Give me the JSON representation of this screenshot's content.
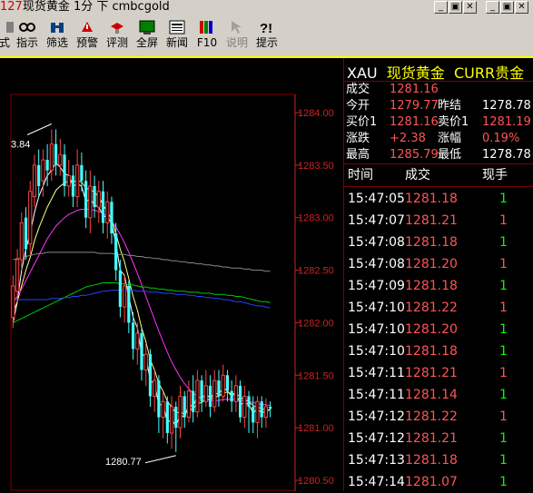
{
  "window": {
    "title_prefix": "127",
    "title_main": "现货黄金 1分 下 cmbcgold",
    "controls": [
      "_",
      "▣",
      "✕",
      "_",
      "▣",
      "✕"
    ]
  },
  "toolbar": {
    "items": [
      {
        "label": "式",
        "icon": "formula-icon"
      },
      {
        "label": "指示",
        "icon": "indicator-icon"
      },
      {
        "label": "筛选",
        "icon": "binoculars-icon"
      },
      {
        "label": "预警",
        "icon": "alert-icon"
      },
      {
        "label": "评测",
        "icon": "evaluate-icon"
      },
      {
        "label": "全屏",
        "icon": "fullscreen-icon"
      },
      {
        "label": "新闻",
        "icon": "news-icon"
      },
      {
        "label": "F10",
        "icon": "books-icon"
      },
      {
        "label": "说明",
        "icon": "help-arrow-icon",
        "disabled": true
      },
      {
        "label": "提示",
        "icon": "hint-icon"
      }
    ]
  },
  "chart": {
    "price_labels": [
      "1284.00",
      "1283.50",
      "1283.00",
      "1282.50",
      "1282.00",
      "1281.50",
      "1281.00",
      "1280.50"
    ],
    "high_annotation": "3.84",
    "low_annotation": "1280.77"
  },
  "chart_data": {
    "type": "candlestick",
    "ylim": [
      1280.5,
      1284.1
    ],
    "yticks": [
      1280.5,
      1281.0,
      1281.5,
      1282.0,
      1282.5,
      1283.0,
      1283.5,
      1284.0
    ],
    "candles": [
      {
        "o": 1282.05,
        "c": 1282.35,
        "h": 1282.45,
        "l": 1281.95,
        "up": true
      },
      {
        "o": 1282.3,
        "c": 1282.6,
        "h": 1282.7,
        "l": 1282.2,
        "up": true
      },
      {
        "o": 1282.6,
        "c": 1282.95,
        "h": 1283.05,
        "l": 1282.5,
        "up": true
      },
      {
        "o": 1283.0,
        "c": 1282.7,
        "h": 1283.1,
        "l": 1282.6,
        "up": false
      },
      {
        "o": 1282.75,
        "c": 1283.25,
        "h": 1283.35,
        "l": 1282.65,
        "up": true
      },
      {
        "o": 1283.2,
        "c": 1283.5,
        "h": 1283.6,
        "l": 1283.1,
        "up": true
      },
      {
        "o": 1283.5,
        "c": 1283.3,
        "h": 1283.65,
        "l": 1283.2,
        "up": false
      },
      {
        "o": 1283.35,
        "c": 1283.55,
        "h": 1283.65,
        "l": 1283.2,
        "up": true
      },
      {
        "o": 1283.55,
        "c": 1283.45,
        "h": 1283.7,
        "l": 1283.3,
        "up": false
      },
      {
        "o": 1283.45,
        "c": 1283.7,
        "h": 1283.84,
        "l": 1283.35,
        "up": true
      },
      {
        "o": 1283.7,
        "c": 1283.5,
        "h": 1283.84,
        "l": 1283.4,
        "up": false
      },
      {
        "o": 1283.5,
        "c": 1283.6,
        "h": 1283.75,
        "l": 1283.4,
        "up": true
      },
      {
        "o": 1283.6,
        "c": 1283.3,
        "h": 1283.7,
        "l": 1283.2,
        "up": false
      },
      {
        "o": 1283.3,
        "c": 1283.4,
        "h": 1283.55,
        "l": 1283.2,
        "up": true
      },
      {
        "o": 1283.4,
        "c": 1283.2,
        "h": 1283.5,
        "l": 1283.1,
        "up": false
      },
      {
        "o": 1283.2,
        "c": 1283.5,
        "h": 1283.65,
        "l": 1283.1,
        "up": true
      },
      {
        "o": 1283.5,
        "c": 1283.35,
        "h": 1283.62,
        "l": 1283.25,
        "up": false
      },
      {
        "o": 1283.35,
        "c": 1283.0,
        "h": 1283.45,
        "l": 1282.9,
        "up": false
      },
      {
        "o": 1283.0,
        "c": 1283.3,
        "h": 1283.45,
        "l": 1282.85,
        "up": true
      },
      {
        "o": 1283.3,
        "c": 1283.1,
        "h": 1283.4,
        "l": 1283.0,
        "up": false
      },
      {
        "o": 1283.1,
        "c": 1283.25,
        "h": 1283.35,
        "l": 1282.95,
        "up": true
      },
      {
        "o": 1283.25,
        "c": 1282.95,
        "h": 1283.35,
        "l": 1282.85,
        "up": false
      },
      {
        "o": 1282.95,
        "c": 1283.15,
        "h": 1283.25,
        "l": 1282.8,
        "up": true
      },
      {
        "o": 1283.15,
        "c": 1282.85,
        "h": 1283.2,
        "l": 1282.75,
        "up": false
      },
      {
        "o": 1282.85,
        "c": 1282.5,
        "h": 1282.95,
        "l": 1282.4,
        "up": false
      },
      {
        "o": 1282.5,
        "c": 1282.15,
        "h": 1282.6,
        "l": 1282.05,
        "up": false
      },
      {
        "o": 1282.15,
        "c": 1282.35,
        "h": 1282.45,
        "l": 1282.0,
        "up": true
      },
      {
        "o": 1282.35,
        "c": 1282.0,
        "h": 1282.4,
        "l": 1281.9,
        "up": false
      },
      {
        "o": 1282.0,
        "c": 1281.75,
        "h": 1282.1,
        "l": 1281.65,
        "up": false
      },
      {
        "o": 1281.75,
        "c": 1281.9,
        "h": 1282.0,
        "l": 1281.6,
        "up": true
      },
      {
        "o": 1281.9,
        "c": 1281.55,
        "h": 1281.95,
        "l": 1281.45,
        "up": false
      },
      {
        "o": 1281.55,
        "c": 1281.7,
        "h": 1281.8,
        "l": 1281.4,
        "up": true
      },
      {
        "o": 1281.7,
        "c": 1281.3,
        "h": 1281.75,
        "l": 1281.2,
        "up": false
      },
      {
        "o": 1281.3,
        "c": 1281.45,
        "h": 1281.55,
        "l": 1281.15,
        "up": true
      },
      {
        "o": 1281.45,
        "c": 1281.1,
        "h": 1281.5,
        "l": 1280.95,
        "up": false
      },
      {
        "o": 1281.1,
        "c": 1281.25,
        "h": 1281.35,
        "l": 1280.9,
        "up": true
      },
      {
        "o": 1281.25,
        "c": 1280.95,
        "h": 1281.3,
        "l": 1280.85,
        "up": false
      },
      {
        "o": 1280.95,
        "c": 1281.2,
        "h": 1281.3,
        "l": 1280.8,
        "up": true
      },
      {
        "o": 1281.2,
        "c": 1281.0,
        "h": 1281.25,
        "l": 1280.77,
        "up": false
      },
      {
        "o": 1281.0,
        "c": 1281.3,
        "h": 1281.4,
        "l": 1280.9,
        "up": true
      },
      {
        "o": 1281.3,
        "c": 1281.1,
        "h": 1281.35,
        "l": 1281.0,
        "up": false
      },
      {
        "o": 1281.1,
        "c": 1281.35,
        "h": 1281.45,
        "l": 1281.05,
        "up": true
      },
      {
        "o": 1281.35,
        "c": 1281.15,
        "h": 1281.5,
        "l": 1281.05,
        "up": false
      },
      {
        "o": 1281.15,
        "c": 1281.45,
        "h": 1281.55,
        "l": 1281.1,
        "up": true
      },
      {
        "o": 1281.45,
        "c": 1281.25,
        "h": 1281.5,
        "l": 1281.15,
        "up": false
      },
      {
        "o": 1281.25,
        "c": 1281.4,
        "h": 1281.55,
        "l": 1281.2,
        "up": true
      },
      {
        "o": 1281.4,
        "c": 1281.2,
        "h": 1281.5,
        "l": 1281.1,
        "up": false
      },
      {
        "o": 1281.2,
        "c": 1281.45,
        "h": 1281.55,
        "l": 1281.15,
        "up": true
      },
      {
        "o": 1281.45,
        "c": 1281.3,
        "h": 1281.55,
        "l": 1281.2,
        "up": false
      },
      {
        "o": 1281.3,
        "c": 1281.5,
        "h": 1281.6,
        "l": 1281.25,
        "up": true
      },
      {
        "o": 1281.5,
        "c": 1281.35,
        "h": 1281.55,
        "l": 1281.25,
        "up": false
      },
      {
        "o": 1281.35,
        "c": 1281.25,
        "h": 1281.45,
        "l": 1281.15,
        "up": false
      },
      {
        "o": 1281.25,
        "c": 1281.4,
        "h": 1281.5,
        "l": 1281.15,
        "up": true
      },
      {
        "o": 1281.4,
        "c": 1281.1,
        "h": 1281.45,
        "l": 1281.05,
        "up": false
      },
      {
        "o": 1281.1,
        "c": 1281.3,
        "h": 1281.4,
        "l": 1281.0,
        "up": true
      },
      {
        "o": 1281.3,
        "c": 1281.2,
        "h": 1281.35,
        "l": 1280.95,
        "up": false
      },
      {
        "o": 1281.2,
        "c": 1281.05,
        "h": 1281.3,
        "l": 1280.95,
        "up": false
      },
      {
        "o": 1281.05,
        "c": 1281.25,
        "h": 1281.3,
        "l": 1280.9,
        "up": true
      },
      {
        "o": 1281.25,
        "c": 1281.1,
        "h": 1281.3,
        "l": 1281.0,
        "up": false
      },
      {
        "o": 1281.1,
        "c": 1281.2,
        "h": 1281.28,
        "l": 1281.0,
        "up": true
      },
      {
        "o": 1281.2,
        "c": 1281.18,
        "h": 1281.25,
        "l": 1281.1,
        "up": false
      }
    ],
    "ma_series": [
      {
        "color": "#ffffff",
        "points": [
          1282.0,
          1282.2,
          1282.5,
          1282.7,
          1282.85,
          1283.05,
          1283.2,
          1283.3,
          1283.4,
          1283.45,
          1283.52,
          1283.48,
          1283.42,
          1283.4,
          1283.3,
          1283.32,
          1283.3,
          1283.15,
          1283.18,
          1283.12,
          1283.1,
          1283.02,
          1283.0,
          1282.95,
          1282.75,
          1282.5,
          1282.45,
          1282.25,
          1282.05,
          1281.95,
          1281.7,
          1281.68,
          1281.45,
          1281.42,
          1281.22,
          1281.22,
          1281.05,
          1281.08,
          1281.02,
          1281.12,
          1281.1,
          1281.22,
          1281.2,
          1281.3,
          1281.28,
          1281.32,
          1281.28,
          1281.33,
          1281.32,
          1281.38,
          1281.35,
          1281.3,
          1281.33,
          1281.22,
          1281.24,
          1281.22,
          1281.14,
          1281.18,
          1281.14,
          1281.16,
          1281.17
        ]
      },
      {
        "color": "#ffff88",
        "points": [
          1282.1,
          1282.2,
          1282.35,
          1282.5,
          1282.62,
          1282.78,
          1282.9,
          1283.0,
          1283.1,
          1283.18,
          1283.26,
          1283.3,
          1283.33,
          1283.35,
          1283.34,
          1283.35,
          1283.34,
          1283.28,
          1283.27,
          1283.24,
          1283.2,
          1283.12,
          1283.06,
          1282.98,
          1282.85,
          1282.7,
          1282.58,
          1282.42,
          1282.25,
          1282.12,
          1281.95,
          1281.82,
          1281.65,
          1281.55,
          1281.42,
          1281.35,
          1281.25,
          1281.2,
          1281.14,
          1281.15,
          1281.13,
          1281.17,
          1281.18,
          1281.23,
          1281.24,
          1281.27,
          1281.27,
          1281.29,
          1281.3,
          1281.33,
          1281.34,
          1281.32,
          1281.33,
          1281.29,
          1281.27,
          1281.25,
          1281.21,
          1281.2,
          1281.18,
          1281.17,
          1281.17
        ]
      },
      {
        "color": "#ff33ff",
        "points": [
          1282.2,
          1282.25,
          1282.32,
          1282.4,
          1282.48,
          1282.56,
          1282.64,
          1282.72,
          1282.8,
          1282.86,
          1282.92,
          1282.96,
          1283.0,
          1283.03,
          1283.05,
          1283.07,
          1283.08,
          1283.08,
          1283.08,
          1283.07,
          1283.06,
          1283.04,
          1283.01,
          1282.97,
          1282.91,
          1282.84,
          1282.76,
          1282.67,
          1282.57,
          1282.47,
          1282.36,
          1282.25,
          1282.14,
          1282.03,
          1281.92,
          1281.82,
          1281.72,
          1281.63,
          1281.55,
          1281.48,
          1281.42,
          1281.37,
          1281.33,
          1281.3,
          1281.28,
          1281.27,
          1281.26,
          1281.26,
          1281.26,
          1281.27,
          1281.27,
          1281.27,
          1281.27,
          1281.26,
          1281.26,
          1281.25,
          1281.24,
          1281.23,
          1281.22,
          1281.22,
          1281.21
        ]
      },
      {
        "color": "#888888",
        "points": [
          1282.6,
          1282.61,
          1282.62,
          1282.63,
          1282.64,
          1282.65,
          1282.66,
          1282.66,
          1282.67,
          1282.67,
          1282.67,
          1282.67,
          1282.67,
          1282.67,
          1282.67,
          1282.67,
          1282.67,
          1282.67,
          1282.67,
          1282.67,
          1282.66,
          1282.66,
          1282.66,
          1282.66,
          1282.65,
          1282.65,
          1282.65,
          1282.64,
          1282.64,
          1282.63,
          1282.63,
          1282.62,
          1282.62,
          1282.61,
          1282.61,
          1282.6,
          1282.6,
          1282.59,
          1282.59,
          1282.58,
          1282.58,
          1282.57,
          1282.57,
          1282.56,
          1282.56,
          1282.55,
          1282.55,
          1282.54,
          1282.54,
          1282.53,
          1282.53,
          1282.52,
          1282.52,
          1282.52,
          1282.51,
          1282.51,
          1282.5,
          1282.5,
          1282.5,
          1282.49,
          1282.49
        ]
      },
      {
        "color": "#00cc00",
        "points": [
          1282.0,
          1282.02,
          1282.04,
          1282.06,
          1282.08,
          1282.1,
          1282.12,
          1282.14,
          1282.16,
          1282.18,
          1282.2,
          1282.22,
          1282.24,
          1282.26,
          1282.28,
          1282.3,
          1282.32,
          1282.34,
          1282.35,
          1282.36,
          1282.37,
          1282.38,
          1282.38,
          1282.38,
          1282.38,
          1282.37,
          1282.37,
          1282.36,
          1282.36,
          1282.35,
          1282.34,
          1282.34,
          1282.33,
          1282.33,
          1282.32,
          1282.32,
          1282.31,
          1282.31,
          1282.3,
          1282.3,
          1282.3,
          1282.29,
          1282.29,
          1282.29,
          1282.28,
          1282.28,
          1282.28,
          1282.27,
          1282.27,
          1282.27,
          1282.26,
          1282.26,
          1282.25,
          1282.25,
          1282.24,
          1282.23,
          1282.22,
          1282.21,
          1282.2,
          1282.2,
          1282.19
        ]
      },
      {
        "color": "#2244ff",
        "points": [
          1282.22,
          1282.22,
          1282.22,
          1282.22,
          1282.22,
          1282.22,
          1282.22,
          1282.22,
          1282.22,
          1282.23,
          1282.23,
          1282.23,
          1282.24,
          1282.24,
          1282.25,
          1282.25,
          1282.26,
          1282.26,
          1282.27,
          1282.28,
          1282.29,
          1282.3,
          1282.3,
          1282.31,
          1282.31,
          1282.31,
          1282.31,
          1282.31,
          1282.31,
          1282.3,
          1282.3,
          1282.3,
          1282.29,
          1282.29,
          1282.29,
          1282.28,
          1282.28,
          1282.28,
          1282.27,
          1282.27,
          1282.27,
          1282.26,
          1282.26,
          1282.25,
          1282.25,
          1282.24,
          1282.24,
          1282.23,
          1282.23,
          1282.22,
          1282.22,
          1282.21,
          1282.2,
          1282.2,
          1282.19,
          1282.18,
          1282.17,
          1282.16,
          1282.16,
          1282.15,
          1282.14
        ]
      }
    ]
  },
  "quote": {
    "code": "XAU",
    "name": "现货黄金",
    "tag": "CURR贵金",
    "last_label": "成交",
    "last_value": "1281.16",
    "open_label": "今开",
    "open_value": "1279.77",
    "prevclose_label": "昨结",
    "prevclose_value": "1278.78",
    "bid_label": "买价1",
    "bid_value": "1281.16",
    "ask_label": "卖价1",
    "ask_value": "1281.19",
    "change_label": "涨跌",
    "change_value": "+2.38",
    "pct_label": "涨幅",
    "pct_value": "0.19%",
    "high_label": "最高",
    "high_value": "1285.79",
    "low_label": "最低",
    "low_value": "1278.78"
  },
  "ticks": {
    "headers": {
      "time": "时间",
      "price": "成交",
      "vol": "现手"
    },
    "rows": [
      {
        "time": "15:47:05",
        "price": "1281.18",
        "vol": "1",
        "color": "green"
      },
      {
        "time": "15:47:07",
        "price": "1281.21",
        "vol": "1",
        "color": "red"
      },
      {
        "time": "15:47:08",
        "price": "1281.18",
        "vol": "1",
        "color": "green"
      },
      {
        "time": "15:47:08",
        "price": "1281.20",
        "vol": "1",
        "color": "red"
      },
      {
        "time": "15:47:09",
        "price": "1281.18",
        "vol": "1",
        "color": "green"
      },
      {
        "time": "15:47:10",
        "price": "1281.22",
        "vol": "1",
        "color": "red"
      },
      {
        "time": "15:47:10",
        "price": "1281.20",
        "vol": "1",
        "color": "green"
      },
      {
        "time": "15:47:10",
        "price": "1281.18",
        "vol": "1",
        "color": "green"
      },
      {
        "time": "15:47:11",
        "price": "1281.21",
        "vol": "1",
        "color": "red"
      },
      {
        "time": "15:47:11",
        "price": "1281.14",
        "vol": "1",
        "color": "green"
      },
      {
        "time": "15:47:12",
        "price": "1281.22",
        "vol": "1",
        "color": "red"
      },
      {
        "time": "15:47:12",
        "price": "1281.21",
        "vol": "1",
        "color": "green"
      },
      {
        "time": "15:47:13",
        "price": "1281.18",
        "vol": "1",
        "color": "green"
      },
      {
        "time": "15:47:14",
        "price": "1281.07",
        "vol": "1",
        "color": "green"
      }
    ]
  }
}
